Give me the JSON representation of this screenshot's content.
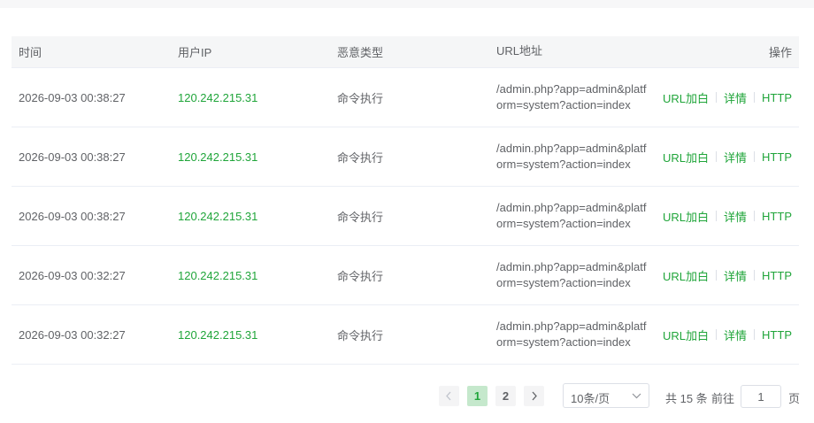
{
  "table": {
    "headers": [
      "时间",
      "用户IP",
      "恶意类型",
      "URL地址",
      "操作"
    ],
    "rows": [
      {
        "time": "2026-09-03 00:38:27",
        "ip": "120.242.215.31",
        "type": "命令执行",
        "url": "/admin.php?app=admin&platform=system?action=index"
      },
      {
        "time": "2026-09-03 00:38:27",
        "ip": "120.242.215.31",
        "type": "命令执行",
        "url": "/admin.php?app=admin&platform=system?action=index"
      },
      {
        "time": "2026-09-03 00:38:27",
        "ip": "120.242.215.31",
        "type": "命令执行",
        "url": "/admin.php?app=admin&platform=system?action=index"
      },
      {
        "time": "2026-09-03 00:32:27",
        "ip": "120.242.215.31",
        "type": "命令执行",
        "url": "/admin.php?app=admin&platform=system?action=index"
      },
      {
        "time": "2026-09-03 00:32:27",
        "ip": "120.242.215.31",
        "type": "命令执行",
        "url": "/admin.php?app=admin&platform=system?action=index"
      }
    ],
    "actions": {
      "url_whitelist": "URL加白",
      "details": "详情",
      "http": "HTTP"
    }
  },
  "pagination": {
    "pages": [
      "1",
      "2"
    ],
    "current_page": "1",
    "page_size": "10条/页",
    "total": "共 15 条",
    "goto_label": "前往",
    "goto_value": "1",
    "page_suffix": "页"
  },
  "colors": {
    "accent": "#20a53a",
    "header_bg": "#f5f6f7",
    "active_page_bg": "#c5e8cc"
  }
}
